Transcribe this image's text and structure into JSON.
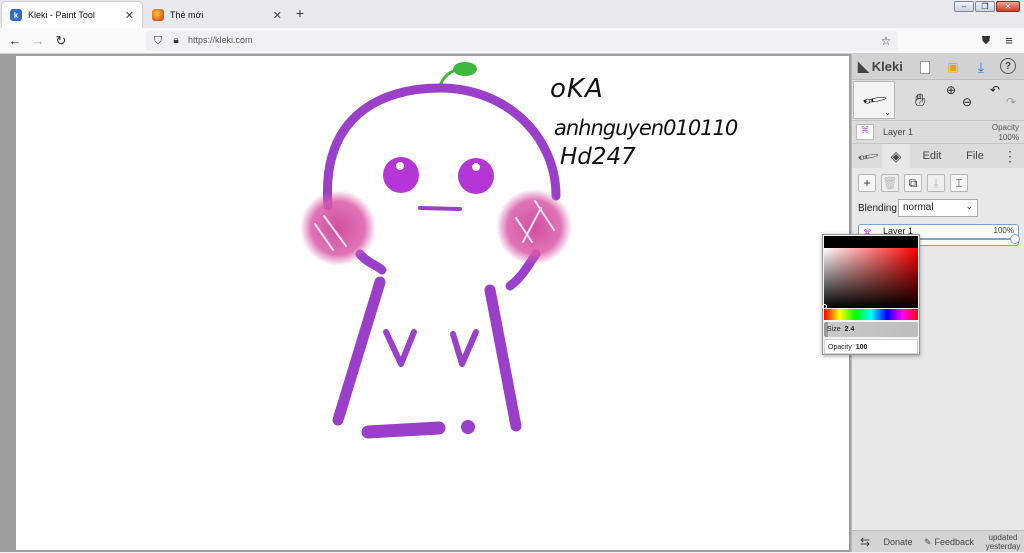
{
  "browser": {
    "tabs": [
      {
        "title": "Kleki - Paint Tool",
        "active": true
      },
      {
        "title": "Thẻ mới",
        "active": false
      }
    ],
    "new_tab_icon": "+",
    "url": "https://kleki.com",
    "window_buttons": [
      "minimize",
      "restore",
      "close"
    ]
  },
  "canvas": {
    "handwriting": [
      "oKA",
      "anhnguyen010110",
      "Hd247"
    ],
    "drawing_color": "#9a3fc9",
    "blush_color": "#d95aa8",
    "sprout_color": "#3db83a"
  },
  "panel": {
    "logo": "Kleki",
    "active_tool": "brush",
    "layer_preview": {
      "name": "Layer 1",
      "opacity_label": "Opacity",
      "opacity_value": "100%"
    },
    "tabs": {
      "edit": "Edit",
      "file": "File"
    },
    "blending_label": "Blending",
    "blending_value": "normal",
    "layers": [
      {
        "name": "Layer 1",
        "opacity": "100%"
      }
    ],
    "footer": {
      "donate": "Donate",
      "feedback": "Feedback",
      "updated_line1": "updated",
      "updated_line2": "yesterday"
    }
  },
  "color_picker": {
    "current_color": "#000000",
    "size_label": "Size",
    "size_value": "2.4",
    "opacity_label": "Opacity",
    "opacity_value": "100"
  }
}
